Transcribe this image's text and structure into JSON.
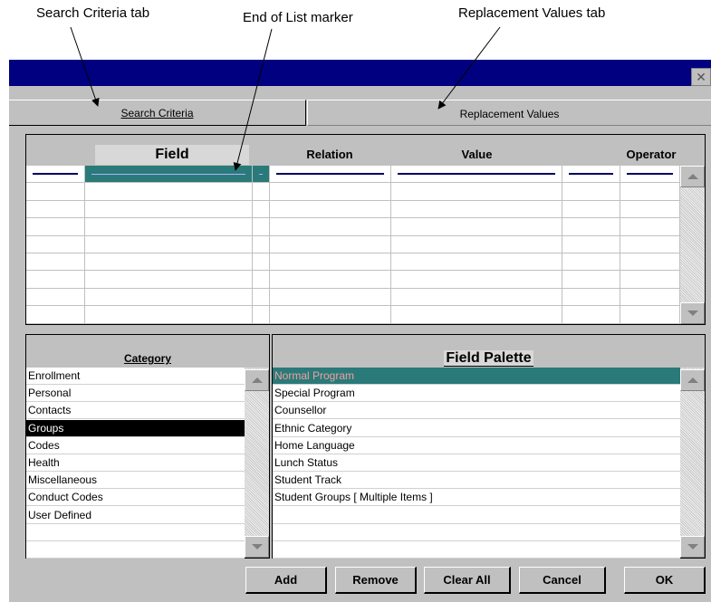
{
  "callouts": {
    "search_tab": "Search Criteria tab",
    "end_of_list": "End of List marker",
    "replacement_tab": "Replacement Values tab"
  },
  "window": {
    "close_icon": "close-icon"
  },
  "tabs": {
    "search": "Search Criteria",
    "replacement": "Replacement Values"
  },
  "grid": {
    "headers": {
      "field": "Field",
      "relation": "Relation",
      "value": "Value",
      "operator": "Operator"
    },
    "row_count": 9
  },
  "category": {
    "title": "Category",
    "items": [
      "Enrollment",
      "Personal",
      "Contacts",
      "Groups",
      "Codes",
      "Health",
      "Miscellaneous",
      "Conduct Codes",
      "User Defined"
    ],
    "selected": "Groups"
  },
  "palette": {
    "title": "Field Palette",
    "items": [
      "Normal Program",
      "Special Program",
      "Counsellor",
      "Ethnic Category",
      "Home Language",
      "Lunch Status",
      "Student Track",
      "Student Groups  [ Multiple Items ]"
    ],
    "selected": "Normal Program"
  },
  "buttons": {
    "add": "Add",
    "remove": "Remove",
    "clear_all": "Clear All",
    "cancel": "Cancel",
    "ok": "OK"
  },
  "colors": {
    "title_bar": "#000080",
    "selection_teal": "#2a7a7a",
    "window_gray": "#c0c0c0"
  }
}
